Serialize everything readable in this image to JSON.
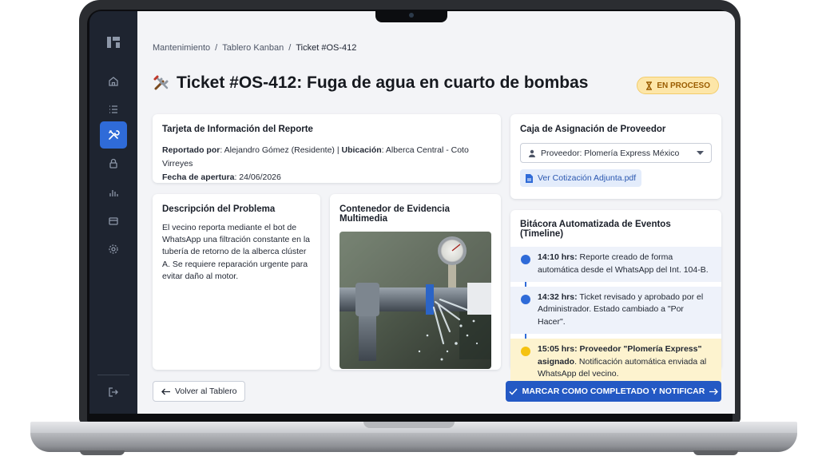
{
  "breadcrumb": {
    "item1": "Mantenimiento",
    "sep1": "/",
    "item2": "Tablero Kanban",
    "sep2": "/",
    "current": "Ticket #OS-412"
  },
  "page": {
    "title": "Ticket #OS-412: Fuga de agua en cuarto de bombas",
    "title_icon": "tools-icon"
  },
  "status": {
    "label": "EN PROCESO",
    "icon": "hourglass-icon",
    "color": "#9a5c00"
  },
  "info": {
    "heading": "Tarjeta de Información del Reporte",
    "reported_by_label": "Reportado por",
    "reported_by_value": ": Alejandro Gómez (Residente) |",
    "location_label": "Ubicación",
    "location_value": ": Alberca Central - Coto Virreyes",
    "opened_label": "Fecha de apertura",
    "opened_value": ": 24/06/2026"
  },
  "assignment": {
    "heading": "Caja de Asignación de Proveedor",
    "select_value": "Proveedor: Plomería Express México",
    "attachment_label": "Ver Cotización Adjunta.pdf"
  },
  "description": {
    "heading": "Descripción del Problema",
    "text": "El vecino reporta mediante el bot de WhatsApp una filtración constante en la tubería de retorno de la alberca clúster A. Se requiere reparación urgente para evitar daño al motor."
  },
  "media": {
    "heading": "Contenedor de Evidencia Multimedia"
  },
  "timeline": {
    "heading": "Bitácora Automatizada de Eventos (Timeline)",
    "events": [
      {
        "time": "14:10 hrs:",
        "text": " Reporte creado de forma automática desde el WhatsApp del Int. 104-B.",
        "color": "#2f6bd8"
      },
      {
        "time": "14:32 hrs:",
        "text": " Ticket revisado y aprobado por el Administrador. Estado cambiado a \"Por Hacer\".",
        "color": "#2f6bd8"
      },
      {
        "time": "15:05 hrs: Proveedor \"Plomería Express\" asignado",
        "text": ". Notificación automática enviada al WhatsApp del vecino.",
        "color": "#f5c211"
      }
    ]
  },
  "actions": {
    "back_label": "Volver al Tablero",
    "complete_label": "MARCAR COMO COMPLETADO Y NOTIFICAR"
  },
  "sidebar": {
    "items": [
      {
        "icon": "home-icon"
      },
      {
        "icon": "list-icon"
      },
      {
        "icon": "tools-icon",
        "active": true
      },
      {
        "icon": "lock-icon"
      },
      {
        "icon": "bar-chart-icon"
      },
      {
        "icon": "card-icon"
      },
      {
        "icon": "gear-icon"
      },
      {
        "icon": "logout-icon"
      }
    ]
  },
  "colors": {
    "accent": "#2f6bd8",
    "primary_button": "#2459c4",
    "sidebar": "#1e2430",
    "badge_bg": "#fde6a8"
  }
}
